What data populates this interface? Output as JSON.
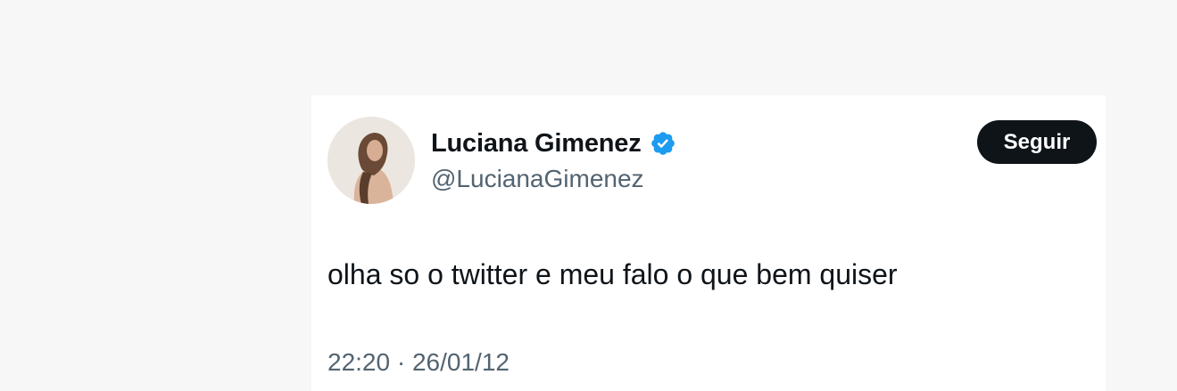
{
  "tweet": {
    "author": {
      "display_name": "Luciana Gimenez",
      "handle": "@LucianaGimenez",
      "verified_icon": "verified-badge-icon",
      "avatar": "profile-photo"
    },
    "follow_label": "Seguir",
    "text": "olha so o twitter e meu falo o que bem quiser",
    "timestamp": {
      "time": "22:20",
      "separator": "·",
      "date": "26/01/12"
    }
  },
  "colors": {
    "page_background": "#f7f7f7",
    "card_background": "#ffffff",
    "primary_text": "#0f1419",
    "secondary_text": "#536471",
    "verified_blue": "#1d9bf0",
    "button_background": "#0f1419",
    "button_text": "#ffffff"
  }
}
